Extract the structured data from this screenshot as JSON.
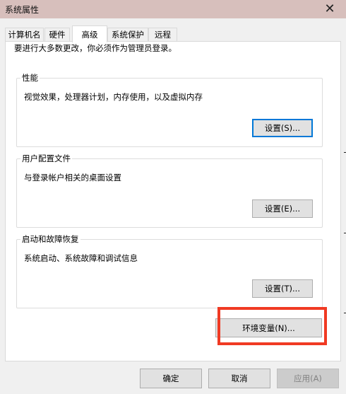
{
  "window": {
    "title": "系统属性"
  },
  "tabs": [
    {
      "label": "计算机名"
    },
    {
      "label": "硬件"
    },
    {
      "label": "高级"
    },
    {
      "label": "系统保护"
    },
    {
      "label": "远程"
    }
  ],
  "admin_note": "要进行大多数更改，你必须作为管理员登录。",
  "performance": {
    "title": "性能",
    "desc": "视觉效果，处理器计划，内存使用，以及虚拟内存",
    "button": "设置(S)..."
  },
  "user_profiles": {
    "title": "用户配置文件",
    "desc": "与登录帐户相关的桌面设置",
    "button": "设置(E)..."
  },
  "startup_recovery": {
    "title": "启动和故障恢复",
    "desc": "系统启动、系统故障和调试信息",
    "button": "设置(T)..."
  },
  "env_button": "环境变量(N)...",
  "footer": {
    "ok": "确定",
    "cancel": "取消",
    "apply": "应用(A)"
  },
  "colors": {
    "titlebar": "#d7bfbc",
    "highlight": "#f03a23",
    "focus": "#0078d7"
  }
}
